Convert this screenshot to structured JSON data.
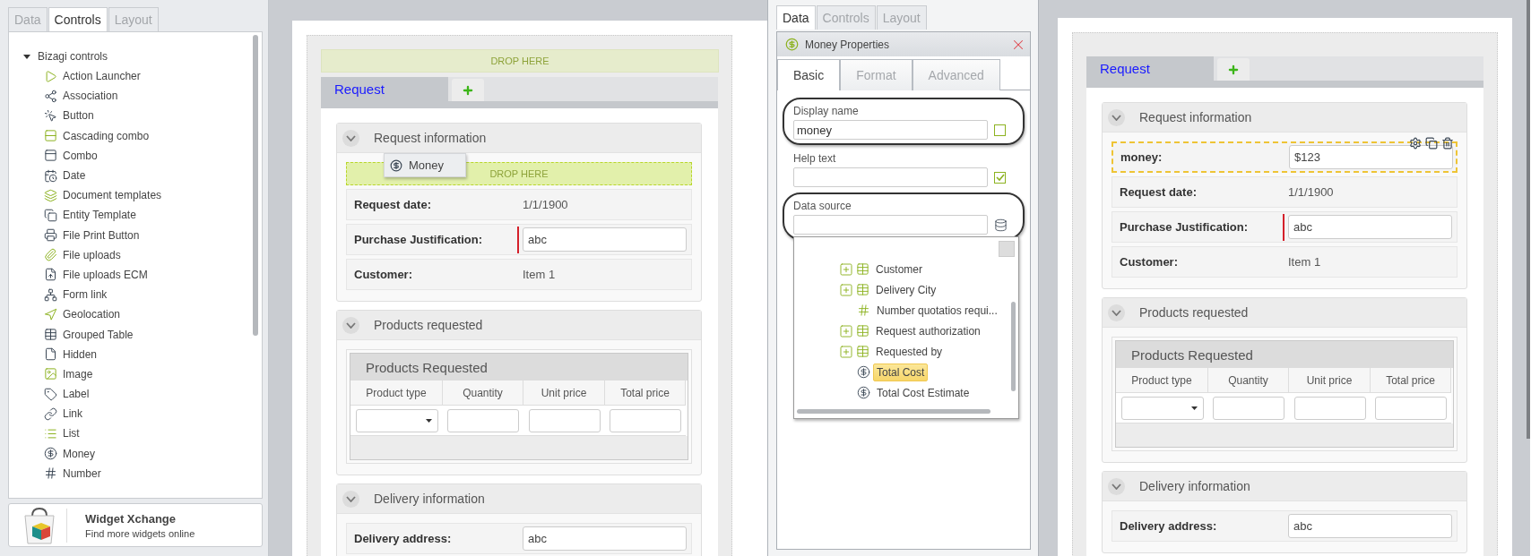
{
  "controls_panel": {
    "tabs": [
      {
        "label": "Data",
        "selected": false
      },
      {
        "label": "Controls",
        "selected": true
      },
      {
        "label": "Layout",
        "selected": false
      }
    ],
    "tree": {
      "label": "Bizagi controls",
      "expanded": true,
      "children": [
        {
          "label": "Action Launcher"
        },
        {
          "label": "Association"
        },
        {
          "label": "Button"
        },
        {
          "label": "Cascading combo"
        },
        {
          "label": "Combo"
        },
        {
          "label": "Date"
        },
        {
          "label": "Document templates"
        },
        {
          "label": "Entity Template"
        },
        {
          "label": "File Print Button"
        },
        {
          "label": "File uploads"
        },
        {
          "label": "File uploads ECM"
        },
        {
          "label": "Form link"
        },
        {
          "label": "Geolocation"
        },
        {
          "label": "Grouped Table"
        },
        {
          "label": "Hidden"
        },
        {
          "label": "Image"
        },
        {
          "label": "Label"
        },
        {
          "label": "Link"
        },
        {
          "label": "List"
        },
        {
          "label": "Money"
        },
        {
          "label": "Number"
        }
      ]
    },
    "widget_xchange": {
      "title": "Widget Xchange",
      "subtitle": "Find more widgets online"
    }
  },
  "form_before": {
    "drop_zone": "DROP HERE",
    "tabs": [
      {
        "label": "Request",
        "selected": true
      }
    ],
    "sections": [
      {
        "title": "Request information",
        "expanded": true,
        "items": [
          {
            "kind": "drop_zone",
            "label": "DROP HERE",
            "dragged": "Money"
          },
          {
            "kind": "text",
            "label": "Request date:",
            "value": "1/1/1900",
            "selected": false
          },
          {
            "kind": "input",
            "label": "Purchase Justification:",
            "value": "abc",
            "required": true,
            "selected": false
          },
          {
            "kind": "text",
            "label": "Customer:",
            "value": "Item 1",
            "selected": false
          }
        ]
      },
      {
        "title": "Products requested",
        "expanded": true,
        "items": [
          {
            "kind": "table",
            "title": "Products Requested",
            "columns": [
              "Product type",
              "Quantity",
              "Unit price",
              "Total price"
            ],
            "cells": [
              {
                "kind": "dropdown"
              },
              {
                "kind": "input"
              },
              {
                "kind": "input"
              },
              {
                "kind": "input"
              }
            ]
          }
        ]
      },
      {
        "title": "Delivery information",
        "expanded": true,
        "items": [
          {
            "kind": "input",
            "label": "Delivery address:",
            "value": "abc",
            "required": false,
            "selected": false
          }
        ]
      }
    ]
  },
  "properties_panel": {
    "tabs": [
      {
        "label": "Data",
        "selected": true
      },
      {
        "label": "Controls",
        "selected": false
      },
      {
        "label": "Layout",
        "selected": false
      }
    ],
    "title": "Money Properties",
    "subtabs": [
      {
        "label": "Basic",
        "selected": true
      },
      {
        "label": "Format",
        "selected": false
      },
      {
        "label": "Advanced",
        "selected": false
      }
    ],
    "fields": [
      {
        "label": "Display name",
        "value": "money",
        "checked": false,
        "highlighted": true,
        "kind": "checkbox"
      },
      {
        "label": "Help text",
        "checked": true,
        "highlighted": false,
        "kind": "checkbox"
      },
      {
        "label": "Data source",
        "highlighted": true,
        "kind": "source"
      }
    ],
    "source_tree": [
      {
        "label": "Customer",
        "kind": "entity",
        "expandable": true,
        "selected": false
      },
      {
        "label": "Delivery City",
        "kind": "entity",
        "expandable": true,
        "selected": false
      },
      {
        "label": "Number quotatios requi...",
        "kind": "number",
        "expandable": false,
        "selected": false
      },
      {
        "label": "Request authorization",
        "kind": "entity",
        "expandable": true,
        "selected": false
      },
      {
        "label": "Requested by",
        "kind": "entity",
        "expandable": true,
        "selected": false
      },
      {
        "label": "Total Cost",
        "kind": "money",
        "expandable": false,
        "selected": true
      },
      {
        "label": "Total Cost Estimate",
        "kind": "money",
        "expandable": false,
        "selected": false
      }
    ]
  },
  "form_after": {
    "tabs": [
      {
        "label": "Request",
        "selected": true
      }
    ],
    "sections": [
      {
        "title": "Request information",
        "expanded": true,
        "items": [
          {
            "kind": "input",
            "label": "money:",
            "value": "$123",
            "required": false,
            "selected": true
          },
          {
            "kind": "text",
            "label": "Request date:",
            "value": "1/1/1900",
            "selected": false
          },
          {
            "kind": "input",
            "label": "Purchase Justification:",
            "value": "abc",
            "required": true,
            "selected": false
          },
          {
            "kind": "text",
            "label": "Customer:",
            "value": "Item 1",
            "selected": false
          }
        ]
      },
      {
        "title": "Products requested",
        "expanded": true,
        "items": [
          {
            "kind": "table",
            "title": "Products Requested",
            "columns": [
              "Product type",
              "Quantity",
              "Unit price",
              "Total price"
            ],
            "cells": [
              {
                "kind": "dropdown"
              },
              {
                "kind": "input"
              },
              {
                "kind": "input"
              },
              {
                "kind": "input"
              }
            ]
          }
        ]
      },
      {
        "title": "Delivery information",
        "expanded": true,
        "items": [
          {
            "kind": "input",
            "label": "Delivery address:",
            "value": "abc",
            "required": false,
            "selected": false
          }
        ]
      }
    ]
  }
}
